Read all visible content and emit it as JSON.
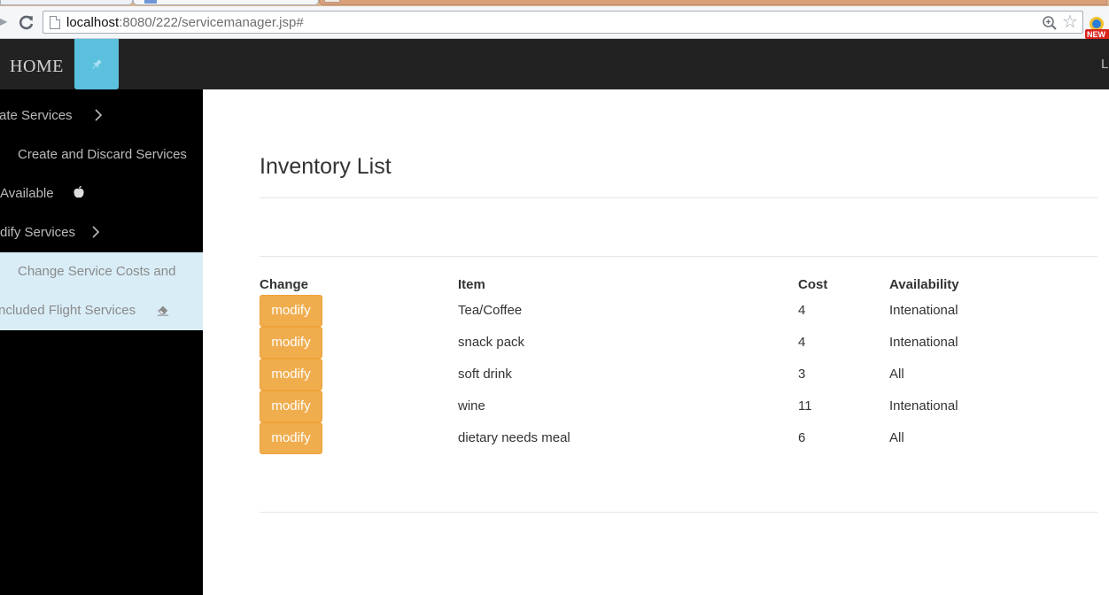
{
  "browser": {
    "url_host": "localhost",
    "url_path": ":8080/222/servicemanager.jsp#",
    "extension_badge": "NEW"
  },
  "header": {
    "brand": "HOME",
    "right_text": "L"
  },
  "sidebar": {
    "items": [
      {
        "label": "ate Services",
        "icon": "chevron-right-icon"
      },
      {
        "label": "Create and Discard Services"
      },
      {
        "label": "Available",
        "icon": "apple-icon"
      },
      {
        "label": "dify Services",
        "icon": "chevron-right-icon"
      },
      {
        "label": "Change Service Costs and"
      },
      {
        "label": "ncluded Flight Services",
        "icon": "eraser-icon"
      }
    ],
    "active_items": [
      4,
      5
    ]
  },
  "main": {
    "title": "Inventory List",
    "table": {
      "headers": [
        "Change",
        "Item",
        "Cost",
        "Availability"
      ],
      "button_label": "modify",
      "rows": [
        {
          "item": "Tea/Coffee",
          "cost": "4",
          "availability": "Intenational"
        },
        {
          "item": "snack pack",
          "cost": "4",
          "availability": "Intenational"
        },
        {
          "item": "soft drink",
          "cost": "3",
          "availability": "All"
        },
        {
          "item": "wine",
          "cost": "11",
          "availability": "Intenational"
        },
        {
          "item": "dietary needs meal",
          "cost": "6",
          "availability": "All"
        }
      ]
    }
  },
  "colors": {
    "appbar": "#222222",
    "pin_button": "#5bc0de",
    "modify_button": "#f0ad4e",
    "sidebar": "#000000",
    "sidebar_active": "#d9edf7"
  }
}
